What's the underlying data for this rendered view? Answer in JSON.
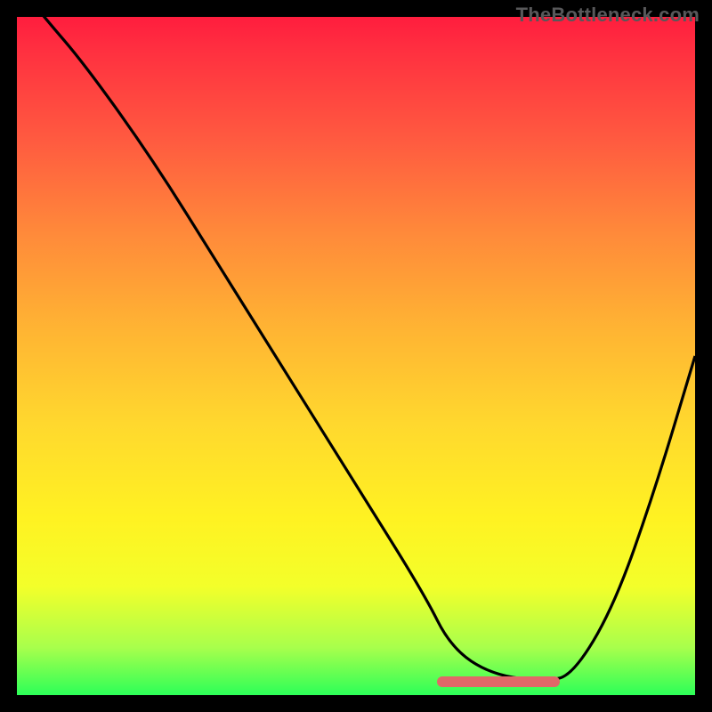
{
  "watermark": "TheBottleneck.com",
  "colors": {
    "page_bg": "#000000",
    "gradient_top": "#ff1d3e",
    "gradient_bottom": "#2cff58",
    "curve": "#000000",
    "plateau": "#e06868",
    "watermark": "#58585a"
  },
  "chart_data": {
    "type": "line",
    "title": "",
    "xlabel": "",
    "ylabel": "",
    "xlim": [
      0,
      100
    ],
    "ylim": [
      0,
      100
    ],
    "grid": false,
    "series": [
      {
        "name": "curve",
        "x": [
          0,
          4,
          10,
          20,
          30,
          40,
          50,
          60,
          64,
          70,
          78,
          82,
          88,
          94,
          100
        ],
        "y": [
          105,
          100,
          93,
          79,
          63,
          47,
          31,
          15,
          7,
          3,
          2,
          3,
          13,
          30,
          50
        ]
      }
    ],
    "plateau": {
      "x_start": 62,
      "x_end": 80,
      "y": 2
    }
  }
}
